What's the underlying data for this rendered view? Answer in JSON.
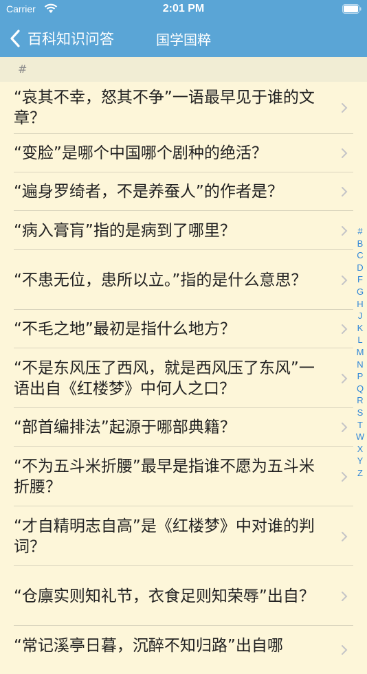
{
  "status": {
    "carrier": "Carrier",
    "time": "2:01 PM"
  },
  "nav": {
    "back_label": "百科知识问答",
    "title": "国学国粹"
  },
  "section": {
    "header": "#"
  },
  "rows": [
    {
      "text": "“哀其不幸，怒其不争”一语最早见于谁的文章？"
    },
    {
      "text": "“变脸”是哪个中国哪个剧种的绝活？"
    },
    {
      "text": "“遍身罗绮者，不是养蚕人”的作者是？"
    },
    {
      "text": "“病入膏肓”指的是病到了哪里？"
    },
    {
      "text": "“不患无位，患所以立。”指的是什么意思？"
    },
    {
      "text": "“不毛之地”最初是指什么地方？"
    },
    {
      "text": "“不是东风压了西风，就是西风压了东风”一语出自《红楼梦》中何人之口？"
    },
    {
      "text": "“部首编排法”起源于哪部典籍？"
    },
    {
      "text": "“不为五斗米折腰”最早是指谁不愿为五斗米折腰？"
    },
    {
      "text": "“才自精明志自高”是《红楼梦》中对谁的判词？"
    },
    {
      "text": "“仓廪实则知礼节，衣食足则知荣辱”出自？"
    },
    {
      "text": "“常记溪亭日暮，沉醉不知归路”出自哪"
    }
  ],
  "index": [
    "#",
    "B",
    "C",
    "D",
    "F",
    "G",
    "H",
    "J",
    "K",
    "L",
    "M",
    "N",
    "P",
    "Q",
    "R",
    "S",
    "T",
    "W",
    "X",
    "Y",
    "Z"
  ]
}
